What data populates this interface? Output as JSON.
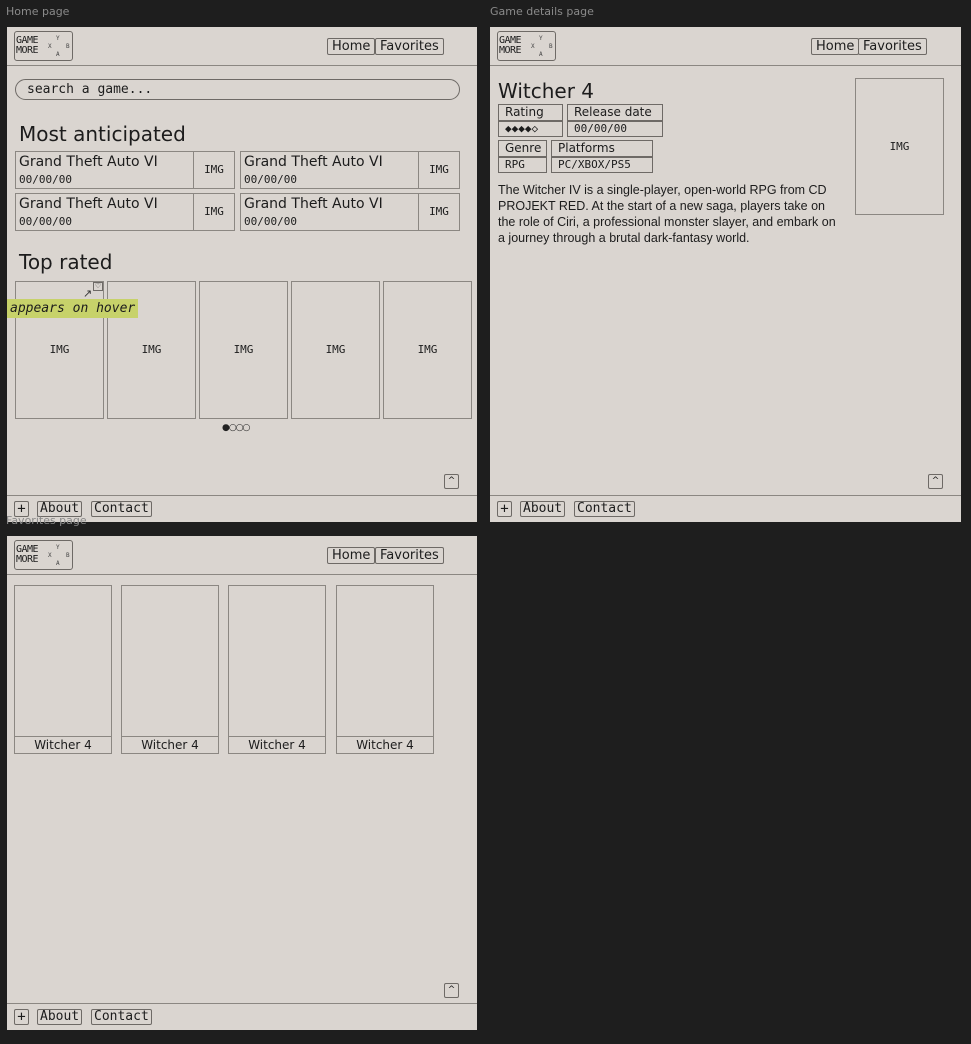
{
  "frame_labels": {
    "home": "Home page",
    "details": "Game details page",
    "favorites": "Favorites page"
  },
  "logo": {
    "line1": "GAME",
    "line2": "MORE",
    "buttons": {
      "y": "Y",
      "x": "X",
      "b": "B",
      "a": "A"
    }
  },
  "nav": {
    "home": "Home",
    "favorites": "Favorites"
  },
  "footer": {
    "plus": "+",
    "about": "About",
    "contact": "Contact",
    "scroll_top": "^"
  },
  "home": {
    "search_placeholder": "search a game...",
    "most_anticipated_heading": "Most anticipated",
    "anticipated": [
      {
        "title": "Grand Theft Auto VI",
        "date": "00/00/00",
        "img": "IMG"
      },
      {
        "title": "Grand Theft Auto VI",
        "date": "00/00/00",
        "img": "IMG"
      },
      {
        "title": "Grand Theft Auto VI",
        "date": "00/00/00",
        "img": "IMG"
      },
      {
        "title": "Grand Theft Auto VI",
        "date": "00/00/00",
        "img": "IMG"
      }
    ],
    "top_rated_heading": "Top rated",
    "top_rated": [
      "IMG",
      "IMG",
      "IMG",
      "IMG",
      "IMG"
    ],
    "heart": "♡",
    "hover_note": "appears on hover",
    "arrow": "↗",
    "pagination": "●○○○"
  },
  "details": {
    "title": "Witcher 4",
    "rating_label": "Rating",
    "rating_value": "◆◆◆◆◇",
    "release_label": "Release date",
    "release_value": "00/00/00",
    "genre_label": "Genre",
    "genre_value": "RPG",
    "platforms_label": "Platforms",
    "platforms_value": "PC/XBOX/PS5",
    "description": "The Witcher IV is a single-player, open-world RPG from CD PROJEKT RED. At the start of a new saga, players take on the role of Ciri, a professional monster slayer, and embark on a journey through a brutal dark-fantasy world.",
    "img": "IMG"
  },
  "favorites": {
    "items": [
      {
        "title": "Witcher 4"
      },
      {
        "title": "Witcher 4"
      },
      {
        "title": "Witcher 4"
      },
      {
        "title": "Witcher 4"
      }
    ]
  }
}
